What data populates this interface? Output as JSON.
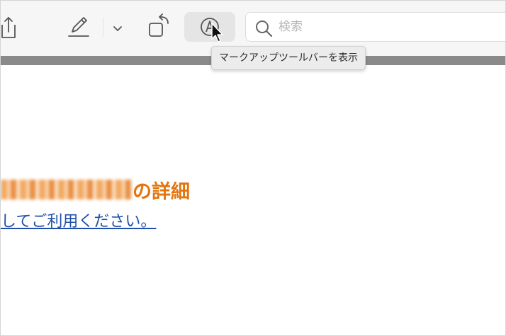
{
  "toolbar": {
    "icons": {
      "share": "share-icon",
      "pen": "pen-icon",
      "chevron": "chevron-down-icon",
      "rotate": "rotate-icon",
      "markup": "markup-icon",
      "search": "search-icon"
    },
    "search": {
      "placeholder": "検索",
      "value": ""
    },
    "tooltip": "マークアップツールバーを表示"
  },
  "document": {
    "heading_suffix": "の詳細",
    "link_text": "してご利用ください。"
  },
  "colors": {
    "toolbar_bg": "#f6f6f6",
    "separator_bar": "#8a8a8a",
    "heading_orange": "#e3750e",
    "link_blue": "#1f4fa8"
  }
}
